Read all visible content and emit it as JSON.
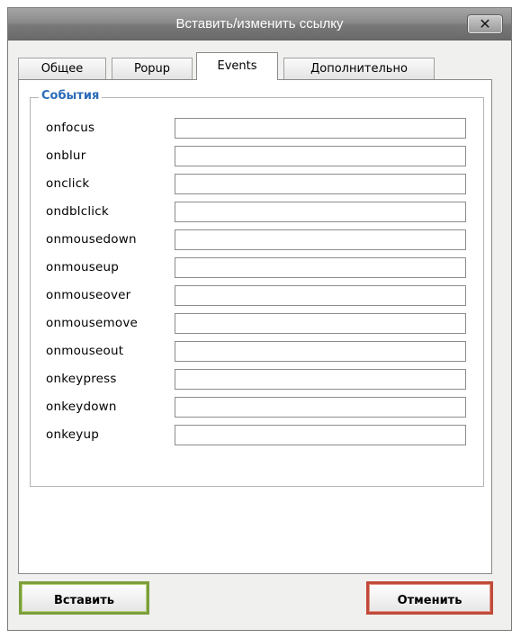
{
  "dialog": {
    "title": "Вставить/изменить ссылку",
    "close_label": "✕"
  },
  "tabs": [
    {
      "label": "Общее",
      "active": false
    },
    {
      "label": "Popup",
      "active": false
    },
    {
      "label": "Events",
      "active": true
    },
    {
      "label": "Дополнительно",
      "active": false
    }
  ],
  "events": {
    "legend": "События",
    "fields": [
      {
        "label": "onfocus",
        "value": ""
      },
      {
        "label": "onblur",
        "value": ""
      },
      {
        "label": "onclick",
        "value": ""
      },
      {
        "label": "ondblclick",
        "value": ""
      },
      {
        "label": "onmousedown",
        "value": ""
      },
      {
        "label": "onmouseup",
        "value": ""
      },
      {
        "label": "onmouseover",
        "value": ""
      },
      {
        "label": "onmousemove",
        "value": ""
      },
      {
        "label": "onmouseout",
        "value": ""
      },
      {
        "label": "onkeypress",
        "value": ""
      },
      {
        "label": "onkeydown",
        "value": ""
      },
      {
        "label": "onkeyup",
        "value": ""
      }
    ]
  },
  "buttons": {
    "insert_label": "Вставить",
    "cancel_label": "Отменить"
  },
  "colors": {
    "legend": "#2b6cb8",
    "insert_border": "#7c9e3c",
    "cancel_border": "#c14a3a"
  }
}
